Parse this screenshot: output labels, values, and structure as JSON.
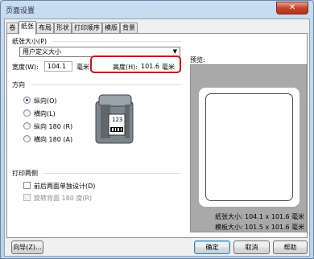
{
  "window": {
    "title": "页面设置",
    "close_symbol": "✕"
  },
  "tabs": [
    {
      "label": "卷",
      "active": false
    },
    {
      "label": "纸张",
      "active": true
    },
    {
      "label": "布局",
      "active": false
    },
    {
      "label": "形状",
      "active": false
    },
    {
      "label": "打印顺序",
      "active": false
    },
    {
      "label": "模版",
      "active": false
    },
    {
      "label": "背景",
      "active": false
    }
  ],
  "paper_size": {
    "group_label": "纸张大小(P)",
    "selected": "用户定义大小",
    "width_label": "宽度(W):",
    "width_value": "104.1",
    "width_unit": "毫米",
    "height_label": "高度(H):",
    "height_value": "101.6",
    "height_unit": "毫米"
  },
  "orientation": {
    "group_label": "方向",
    "options": [
      {
        "label": "纵向(O)",
        "checked": true
      },
      {
        "label": "横向(L)",
        "checked": false
      },
      {
        "label": "纵向 180 (R)",
        "checked": false
      },
      {
        "label": "横向 180 (A)",
        "checked": false
      }
    ],
    "printer_screen_text": "123"
  },
  "duplex": {
    "group_label": "打印两侧",
    "option1": "前后两面单独设计(D)",
    "option2": "旋转背面 180 度(R)"
  },
  "preview": {
    "label": "预览:",
    "paper_size_label": "纸张大小:",
    "paper_size_value": "104.1 x 101.6 毫米",
    "template_size_label": "模板大小:",
    "template_size_value": "101.5 x 101.6 毫米"
  },
  "buttons": {
    "wizard": "向导(Z)...",
    "ok": "确定",
    "cancel": "取消",
    "help": "帮助"
  },
  "colors": {
    "highlight": "#c4161c",
    "accent": "#3c7fb1"
  }
}
